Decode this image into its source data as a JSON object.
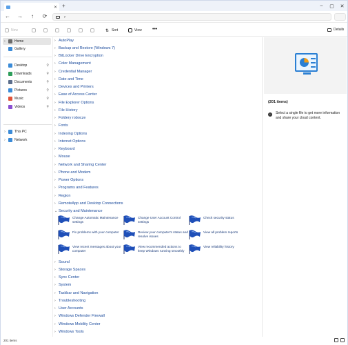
{
  "tabs": {
    "close": "✕",
    "new_tab": "+"
  },
  "window_controls": {
    "minimize": "–",
    "maximize": "▢",
    "close": "✕"
  },
  "nav": {
    "back": "←",
    "forward": "→",
    "up": "↑",
    "refresh": "⟳",
    "address_chevron": "›"
  },
  "toolbar": {
    "new_label": "New",
    "sort_label": "Sort",
    "view_label": "View",
    "more": "•••",
    "details_label": "Details"
  },
  "sidebar": {
    "items": [
      {
        "label": "Home",
        "icon": "home-icon",
        "color": "#6b6b6b"
      },
      {
        "label": "Gallery",
        "icon": "gallery-icon",
        "color": "#3b8bd8"
      },
      {
        "label": "Desktop",
        "icon": "desktop-icon",
        "color": "#3b8bd8"
      },
      {
        "label": "Downloads",
        "icon": "downloads-icon",
        "color": "#2e9e5b"
      },
      {
        "label": "Documents",
        "icon": "documents-icon",
        "color": "#5c6e8c"
      },
      {
        "label": "Pictures",
        "icon": "pictures-icon",
        "color": "#3b8bd8"
      },
      {
        "label": "Music",
        "icon": "music-icon",
        "color": "#e0523a"
      },
      {
        "label": "Videos",
        "icon": "videos-icon",
        "color": "#8a4fd1"
      },
      {
        "label": "This PC",
        "icon": "this-pc-icon",
        "color": "#3b8bd8"
      },
      {
        "label": "Network",
        "icon": "network-icon",
        "color": "#3b8bd8"
      }
    ]
  },
  "categories_top": [
    "AutoPlay",
    "Backup and Restore (Windows 7)",
    "BitLocker Drive Encryption",
    "Color Management",
    "Credential Manager",
    "Date and Time",
    "Devices and Printers",
    "Ease of Access Center",
    "File Explorer Options",
    "File History",
    "Foldery robocze",
    "Fonts",
    "Indexing Options",
    "Internet Options",
    "Keyboard",
    "Mouse",
    "Network and Sharing Center",
    "Phone and Modem",
    "Power Options",
    "Programs and Features",
    "Region",
    "RemoteApp and Desktop Connections",
    "Security and Maintenance"
  ],
  "security_tasks": [
    "Change Automatic Maintenance settings",
    "Change User Account Control settings",
    "Check security status",
    "Fix problems with your computer",
    "Review your computer's status and resolve issues",
    "View all problem reports",
    "View recent messages about your computer",
    "View recommended actions to keep Windows running smoothly",
    "View reliability history"
  ],
  "categories_bottom": [
    "Sound",
    "Storage Spaces",
    "Sync Center",
    "System",
    "Taskbar and Navigation",
    "Troubleshooting",
    "User Accounts",
    "Windows Defender Firewall",
    "Windows Mobility Center",
    "Windows Tools"
  ],
  "details_pane": {
    "count": "(201 items)",
    "info_icon": "i",
    "message": "Select a single file to get more information and share your cloud content."
  },
  "status": {
    "items": "201 items"
  },
  "colors": {
    "link": "#1a4a9c",
    "accent": "#2a7fd3",
    "flag": "#1f4fb8"
  }
}
